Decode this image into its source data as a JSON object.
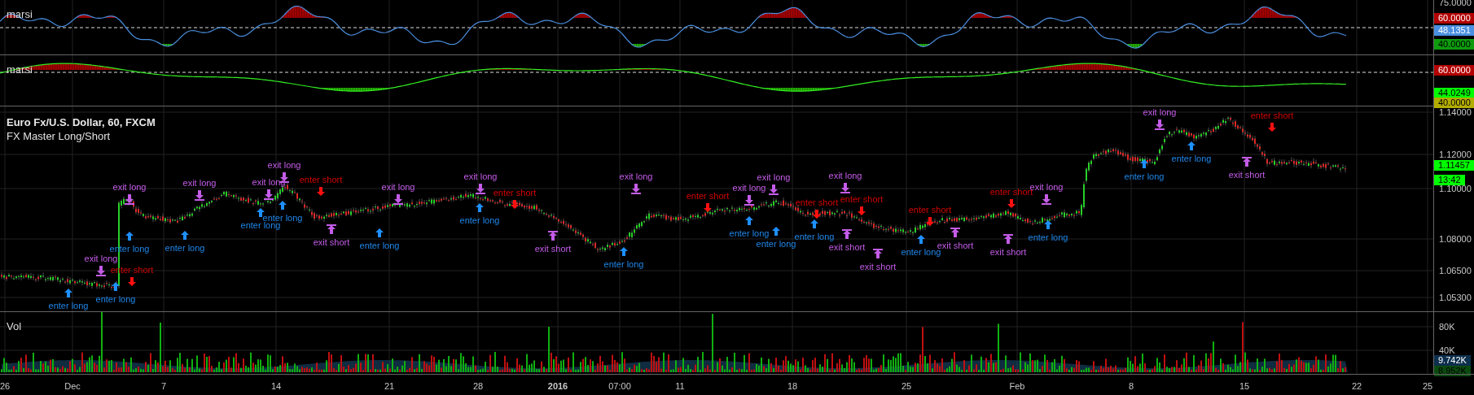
{
  "indicators": [
    {
      "title": "marsi",
      "axis": [
        {
          "text": "75.0000",
          "kind": "tick"
        },
        {
          "text": "60.0000",
          "kind": "badge",
          "color": "#b30000"
        },
        {
          "text": "48.1351",
          "kind": "badge",
          "color": "#4a8fe0"
        },
        {
          "text": "40.0000",
          "kind": "badge_dark",
          "color": "#0e9b0e"
        }
      ]
    },
    {
      "title": "marsi",
      "axis": [
        {
          "text": "60.0000",
          "kind": "badge",
          "color": "#b30000"
        },
        {
          "text": "44.0249",
          "kind": "badge_dark",
          "color": "#00ff00"
        },
        {
          "text": "40.0000",
          "kind": "badge_dark",
          "color": "#b3ad00"
        }
      ]
    }
  ],
  "price_panel": {
    "title": "Euro Fx/U.S. Dollar, 60, FXCM",
    "study": "FX Master Long/Short",
    "axis": [
      {
        "text": "1.14000",
        "kind": "tick"
      },
      {
        "text": "1.12000",
        "kind": "tick"
      },
      {
        "text": "1.11457",
        "kind": "badge_dark",
        "color": "#00ff00"
      },
      {
        "text": "13:42",
        "kind": "badge_dark",
        "color": "#00ff00"
      },
      {
        "text": "1.10000",
        "kind": "tick"
      },
      {
        "text": "1.08000",
        "kind": "tick"
      },
      {
        "text": "1.06500",
        "kind": "tick"
      },
      {
        "text": "1.05300",
        "kind": "tick"
      }
    ],
    "signals": [
      {
        "kind": "exit_long",
        "label": "exit long"
      },
      {
        "kind": "enter_long",
        "label": "enter long"
      },
      {
        "kind": "enter_long",
        "label": "enter long"
      },
      {
        "kind": "exit_long",
        "label": "exit long"
      },
      {
        "kind": "exit_long",
        "label": "exit long"
      },
      {
        "kind": "exit_long",
        "label": "exit long"
      },
      {
        "kind": "enter_long",
        "label": "enter long"
      },
      {
        "kind": "enter_long",
        "label": "enter long"
      },
      {
        "kind": "enter_short",
        "label": "enter short"
      },
      {
        "kind": "exit_long",
        "label": "exit long"
      },
      {
        "kind": "enter_short",
        "label": "enter short"
      },
      {
        "kind": "enter_long",
        "label": "enter long"
      },
      {
        "kind": "enter_long",
        "label": "enter long"
      },
      {
        "kind": "exit_short",
        "label": "exit short"
      },
      {
        "kind": "exit_long",
        "label": "exit long"
      },
      {
        "kind": "enter_long",
        "label": "enter long"
      },
      {
        "kind": "enter_long",
        "label": "enter long"
      },
      {
        "kind": "exit_long",
        "label": "exit long"
      },
      {
        "kind": "enter_short",
        "label": "enter short"
      },
      {
        "kind": "exit_short",
        "label": "exit short"
      },
      {
        "kind": "enter_long",
        "label": "enter long"
      },
      {
        "kind": "exit_long",
        "label": "exit long"
      },
      {
        "kind": "enter_short",
        "label": "enter short"
      },
      {
        "kind": "exit_long",
        "label": "exit long"
      },
      {
        "kind": "exit_long",
        "label": "exit long"
      },
      {
        "kind": "enter_long",
        "label": "enter long"
      },
      {
        "kind": "enter_long",
        "label": "enter long"
      },
      {
        "kind": "enter_short",
        "label": "enter short"
      },
      {
        "kind": "exit_long",
        "label": "exit long"
      },
      {
        "kind": "enter_short",
        "label": "enter short"
      },
      {
        "kind": "enter_long",
        "label": "enter long"
      },
      {
        "kind": "exit_short",
        "label": "exit short"
      },
      {
        "kind": "exit_short",
        "label": "exit short"
      },
      {
        "kind": "enter_long",
        "label": "enter long"
      },
      {
        "kind": "enter_short",
        "label": "enter short"
      },
      {
        "kind": "exit_short",
        "label": "exit short"
      },
      {
        "kind": "enter_short",
        "label": "enter short"
      },
      {
        "kind": "exit_short",
        "label": "exit short"
      },
      {
        "kind": "enter_long",
        "label": "enter long"
      },
      {
        "kind": "exit_long",
        "label": "exit long"
      },
      {
        "kind": "exit_long",
        "label": "exit long"
      },
      {
        "kind": "enter_long",
        "label": "enter long"
      },
      {
        "kind": "enter_long",
        "label": "enter long"
      },
      {
        "kind": "enter_short",
        "label": "enter short"
      },
      {
        "kind": "exit_short",
        "label": "exit short"
      }
    ]
  },
  "volume_panel": {
    "title": "Vol",
    "axis": [
      {
        "text": "80K",
        "kind": "tick"
      },
      {
        "text": "40K",
        "kind": "tick"
      },
      {
        "text": "9.742K",
        "kind": "badge",
        "color": "#0d2f4d"
      },
      {
        "text": "8.952K",
        "kind": "badge_dark",
        "color": "#0b4a10"
      }
    ]
  },
  "time_axis": [
    {
      "text": "26",
      "major": false
    },
    {
      "text": "Dec",
      "major": false
    },
    {
      "text": "7",
      "major": false
    },
    {
      "text": "14",
      "major": false
    },
    {
      "text": "21",
      "major": false
    },
    {
      "text": "28",
      "major": false
    },
    {
      "text": "2016",
      "major": true
    },
    {
      "text": "07:00",
      "major": false
    },
    {
      "text": "11",
      "major": false
    },
    {
      "text": "18",
      "major": false
    },
    {
      "text": "25",
      "major": false
    },
    {
      "text": "Feb",
      "major": false
    },
    {
      "text": "8",
      "major": false
    },
    {
      "text": "15",
      "major": false
    },
    {
      "text": "22",
      "major": false
    },
    {
      "text": "25",
      "major": false
    }
  ]
}
